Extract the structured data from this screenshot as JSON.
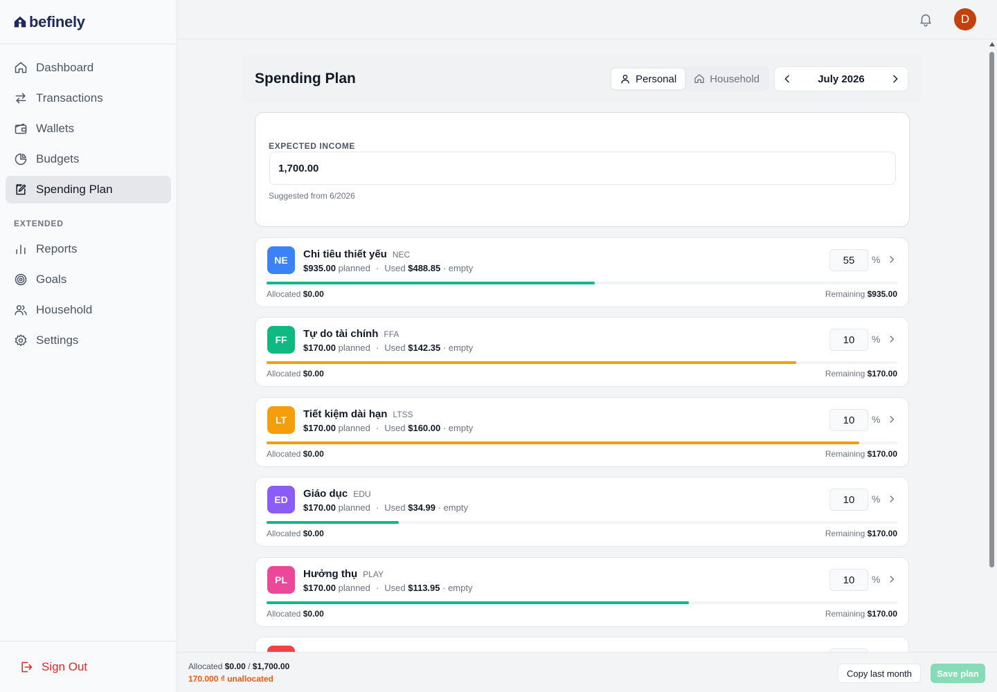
{
  "app": {
    "name": "befinely"
  },
  "sidebar": {
    "items": [
      {
        "label": "Dashboard",
        "icon": "home-icon"
      },
      {
        "label": "Transactions",
        "icon": "transfer-arrows-icon"
      },
      {
        "label": "Wallets",
        "icon": "wallet-icon"
      },
      {
        "label": "Budgets",
        "icon": "pie-chart-icon"
      },
      {
        "label": "Spending Plan",
        "icon": "edit-plan-icon",
        "active": true
      }
    ],
    "section_label": "EXTENDED",
    "extended_items": [
      {
        "label": "Reports",
        "icon": "bar-chart-icon"
      },
      {
        "label": "Goals",
        "icon": "target-icon"
      },
      {
        "label": "Household",
        "icon": "users-icon"
      },
      {
        "label": "Settings",
        "icon": "gear-icon"
      }
    ],
    "sign_out": "Sign Out"
  },
  "topbar": {
    "avatar_initial": "D"
  },
  "header": {
    "title": "Spending Plan",
    "scope_personal": "Personal",
    "scope_household": "Household",
    "month": "July 2026"
  },
  "income": {
    "label": "EXPECTED INCOME",
    "value": "1,700.00",
    "hint": "Suggested from 6/2026"
  },
  "categories": [
    {
      "badge": "NE",
      "color": "#3b82f6",
      "name": "Chi tiêu thiết yếu",
      "code": "NEC",
      "planned": "$935.00",
      "planned_label": "planned",
      "used_label": "Used",
      "used": "$488.85",
      "status": "· empty",
      "percent": "55",
      "progress": 0.52,
      "bar_color": "#10b981",
      "allocated_label": "Allocated",
      "allocated": "$0.00",
      "remaining_label": "Remaining",
      "remaining": "$935.00"
    },
    {
      "badge": "FF",
      "color": "#10b981",
      "name": "Tự do tài chính",
      "code": "FFA",
      "planned": "$170.00",
      "planned_label": "planned",
      "used_label": "Used",
      "used": "$142.35",
      "status": "· empty",
      "percent": "10",
      "progress": 0.84,
      "bar_color": "#f59e0b",
      "allocated_label": "Allocated",
      "allocated": "$0.00",
      "remaining_label": "Remaining",
      "remaining": "$170.00"
    },
    {
      "badge": "LT",
      "color": "#f59e0b",
      "name": "Tiết kiệm dài hạn",
      "code": "LTSS",
      "planned": "$170.00",
      "planned_label": "planned",
      "used_label": "Used",
      "used": "$160.00",
      "status": "· empty",
      "percent": "10",
      "progress": 0.94,
      "bar_color": "#f59e0b",
      "allocated_label": "Allocated",
      "allocated": "$0.00",
      "remaining_label": "Remaining",
      "remaining": "$170.00"
    },
    {
      "badge": "ED",
      "color": "#8b5cf6",
      "name": "Giáo dục",
      "code": "EDU",
      "planned": "$170.00",
      "planned_label": "planned",
      "used_label": "Used",
      "used": "$34.99",
      "status": "· empty",
      "percent": "10",
      "progress": 0.21,
      "bar_color": "#10b981",
      "allocated_label": "Allocated",
      "allocated": "$0.00",
      "remaining_label": "Remaining",
      "remaining": "$170.00"
    },
    {
      "badge": "PL",
      "color": "#ec4899",
      "name": "Hưởng thụ",
      "code": "PLAY",
      "planned": "$170.00",
      "planned_label": "planned",
      "used_label": "Used",
      "used": "$113.95",
      "status": "· empty",
      "percent": "10",
      "progress": 0.67,
      "bar_color": "#10b981",
      "allocated_label": "Allocated",
      "allocated": "$0.00",
      "remaining_label": "Remaining",
      "remaining": "$170.00"
    },
    {
      "badge": "",
      "color": "#ef4444",
      "name": "",
      "code": "",
      "planned": "",
      "planned_label": "",
      "used_label": "",
      "used": "",
      "status": "",
      "percent": "",
      "progress": 0,
      "bar_color": "#10b981",
      "allocated_label": "",
      "allocated": "",
      "remaining_label": "",
      "remaining": ""
    }
  ],
  "footer": {
    "allocated_label": "Allocated",
    "allocated": "$0.00",
    "separator": "/",
    "total": "$1,700.00",
    "unallocated": "170.000 ₫ unallocated",
    "copy_label": "Copy last month",
    "save_label": "Save plan"
  }
}
